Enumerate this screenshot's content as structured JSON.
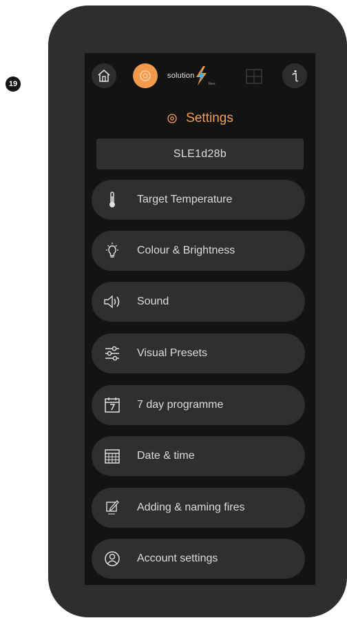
{
  "step_number": "19",
  "header": {
    "logo_text": "solution",
    "logo_subtext": "fires"
  },
  "title": "Settings",
  "device_name": "SLE1d28b",
  "menu": [
    {
      "label": "Target Temperature",
      "icon": "thermometer-icon"
    },
    {
      "label": "Colour & Brightness",
      "icon": "lightbulb-icon"
    },
    {
      "label": "Sound",
      "icon": "speaker-icon"
    },
    {
      "label": "Visual Presets",
      "icon": "sliders-icon"
    },
    {
      "label": "7 day programme",
      "icon": "calendar-icon"
    },
    {
      "label": "Date & time",
      "icon": "calendar-grid-icon"
    },
    {
      "label": "Adding & naming fires",
      "icon": "edit-icon"
    },
    {
      "label": "Account settings",
      "icon": "user-icon"
    }
  ],
  "colors": {
    "accent": "#f0a054",
    "orange_button": "#f29a4c",
    "screen_bg": "#131313",
    "item_bg": "#2f2f2f",
    "phone_body": "#2e2e2e"
  }
}
